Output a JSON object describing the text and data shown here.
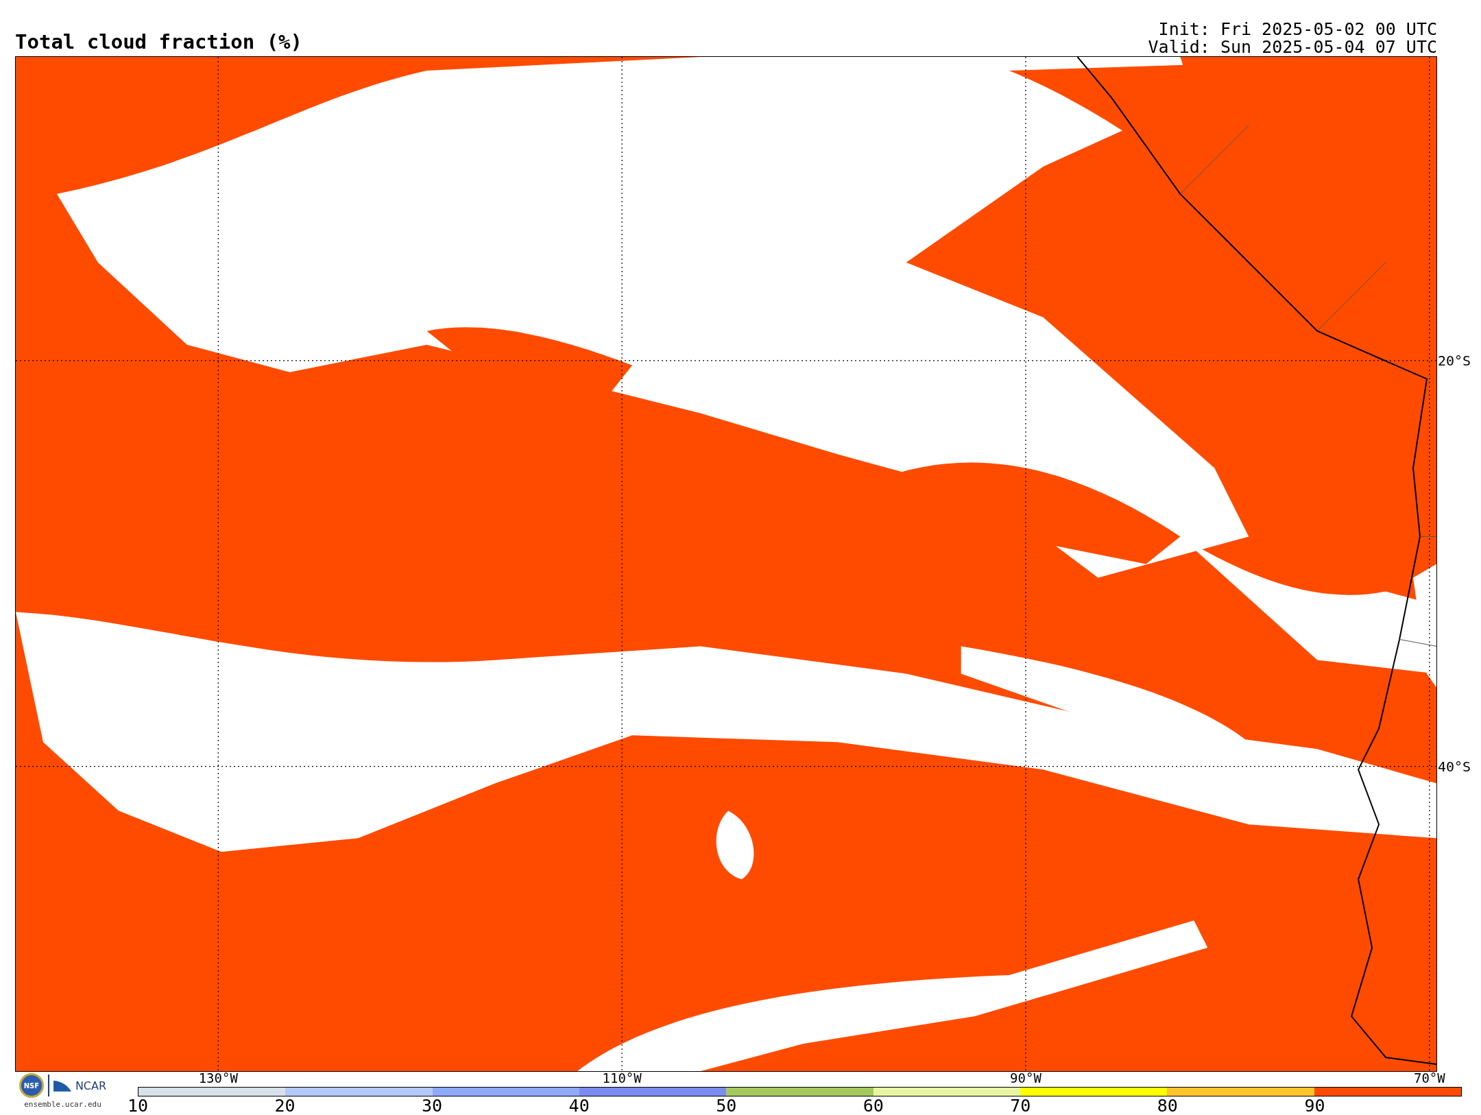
{
  "title": "Total cloud fraction (%)",
  "run_info": [
    "Init: Fri 2025-05-02 00 UTC",
    "Valid: Sun 2025-05-04 07 UTC"
  ],
  "map": {
    "longitude_labels": [
      "130°W",
      "110°W",
      "90°W",
      "70°W"
    ],
    "latitude_labels": [
      "20°S",
      "40°S"
    ]
  },
  "logo": {
    "emblem": "NSF",
    "name": "NCAR",
    "site": "ensemble.ucar.edu"
  },
  "colorbar": {
    "segments": [
      {
        "color": "#d6e1ea"
      },
      {
        "color": "#b4c8fa"
      },
      {
        "color": "#8eaaf8"
      },
      {
        "color": "#7b8bef"
      },
      {
        "color": "#a5c95f"
      },
      {
        "color": "#e8f5a2"
      },
      {
        "color": "#ffff00"
      },
      {
        "color": "#fdc52b"
      },
      {
        "color": "#ff4b00"
      }
    ],
    "ticks": [
      "10",
      "20",
      "30",
      "40",
      "50",
      "60",
      "70",
      "80",
      "90"
    ]
  }
}
